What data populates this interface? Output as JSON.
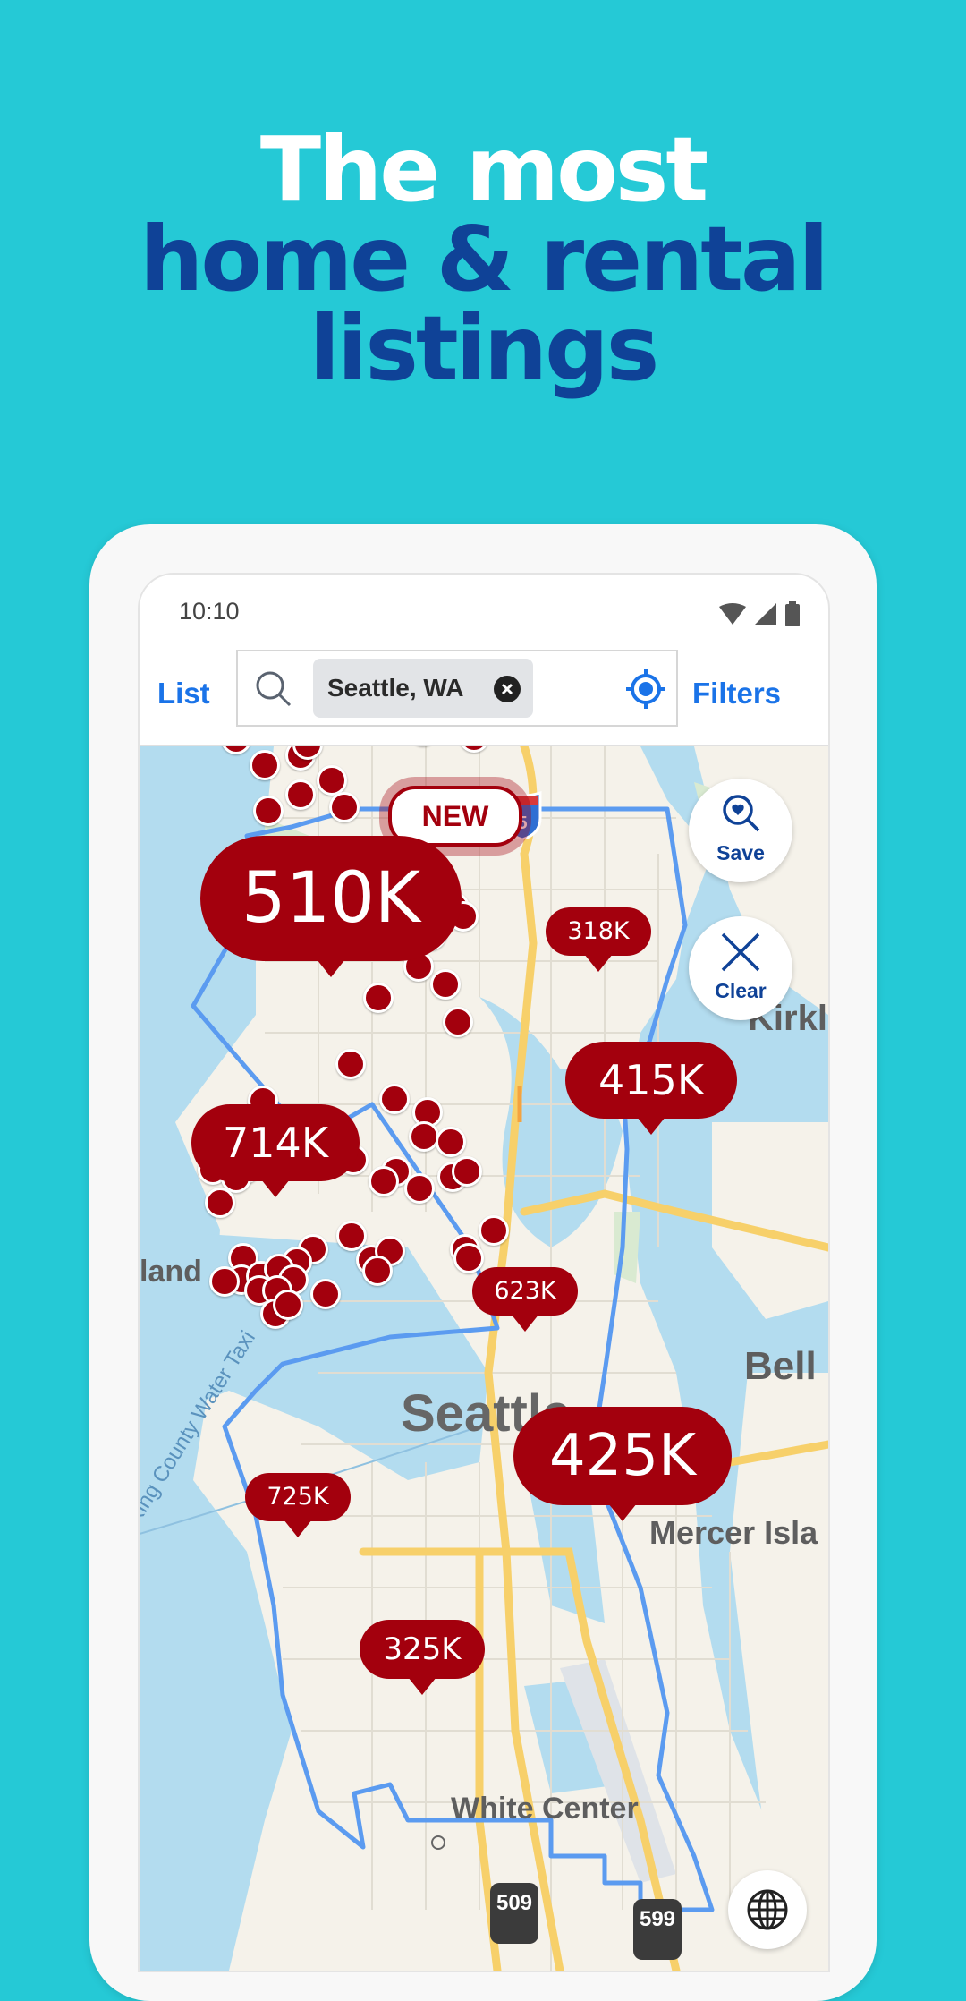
{
  "headline": {
    "line1": "The most",
    "line2": "home & rental",
    "line3": "listings"
  },
  "status_bar": {
    "time": "10:10",
    "icons": [
      "wifi-icon",
      "cell-signal-icon",
      "battery-icon"
    ]
  },
  "toolbar": {
    "list_label": "List",
    "filters_label": "Filters",
    "search": {
      "icon": "search-icon",
      "chip_value": "Seattle, WA",
      "chip_clear_icon": "clear-chip-icon",
      "location_icon": "my-location-icon"
    }
  },
  "map": {
    "new_badge": "NEW",
    "fabs": {
      "save_label": "Save",
      "clear_label": "Clear",
      "globe_icon": "globe-icon"
    },
    "price_bubbles": [
      {
        "label": "510K"
      },
      {
        "label": "318K"
      },
      {
        "label": "415K"
      },
      {
        "label": "714K"
      },
      {
        "label": "623K"
      },
      {
        "label": "425K"
      },
      {
        "label": "725K"
      },
      {
        "label": "325K"
      }
    ],
    "place_labels": {
      "seattle": "Seattle",
      "white_center": "White Center",
      "mercer_island": "Mercer Isla",
      "bellevue": "Bell",
      "kirkland": "Kirkla",
      "island": "land",
      "water_taxi": "King County Water Taxi"
    },
    "route_shields": [
      "5",
      "509",
      "599"
    ],
    "colors": {
      "marker": "#a3000d",
      "boundary": "#5b9bf0",
      "water": "#b3dcef",
      "land": "#f5f2ea",
      "highway": "#f7d06a"
    }
  }
}
